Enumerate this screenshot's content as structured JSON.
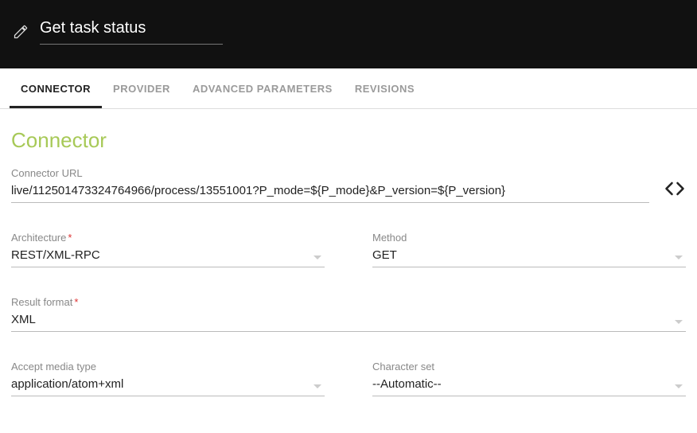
{
  "header": {
    "title": "Get task status"
  },
  "tabs": {
    "connector": "CONNECTOR",
    "provider": "PROVIDER",
    "advanced": "ADVANCED PARAMETERS",
    "revisions": "REVISIONS"
  },
  "section": {
    "title": "Connector"
  },
  "fields": {
    "connector_url": {
      "label": "Connector URL",
      "value": "live/112501473324764966/process/13551001?P_mode=${P_mode}&P_version=${P_version}"
    },
    "architecture": {
      "label": "Architecture",
      "value": "REST/XML-RPC",
      "required": true
    },
    "method": {
      "label": "Method",
      "value": "GET"
    },
    "result_format": {
      "label": "Result format",
      "value": "XML",
      "required": true
    },
    "accept_media": {
      "label": "Accept media type",
      "value": "application/atom+xml"
    },
    "charset": {
      "label": "Character set",
      "value": "--Automatic--"
    }
  }
}
